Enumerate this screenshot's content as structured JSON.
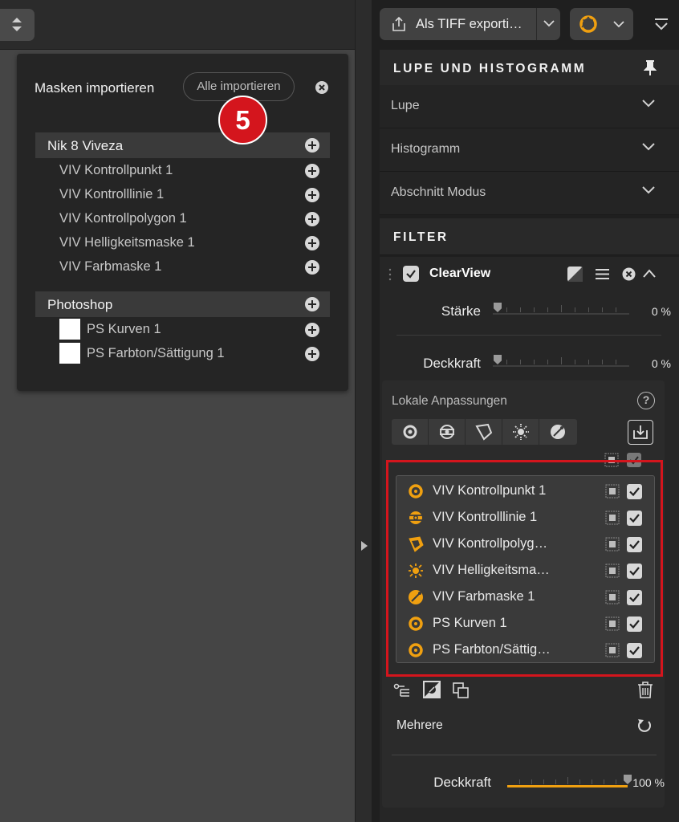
{
  "left": {
    "popup": {
      "title": "Masken importieren",
      "import_all_label": "Alle importieren",
      "step_badge": "5",
      "groups": [
        {
          "name": "Nik 8 Viveza",
          "items": [
            "VIV Kontrollpunkt 1",
            "VIV Kontrolllinie 1",
            "VIV Kontrollpolygon 1",
            "VIV Helligkeitsmaske 1",
            "VIV Farbmaske 1"
          ]
        },
        {
          "name": "Photoshop",
          "items": [
            "PS Kurven 1",
            "PS Farbton/Sättigung 1"
          ]
        }
      ]
    }
  },
  "right": {
    "export_label": "Als TIFF exporti…",
    "sections": {
      "lupe_histogramm": "LUPE UND HISTOGRAMM",
      "lupe": "Lupe",
      "histogramm": "Histogramm",
      "abschnitt_modus": "Abschnitt Modus",
      "filter": "FILTER"
    },
    "clearview": {
      "title": "ClearView",
      "staerke_label": "Stärke",
      "staerke_value": "0 %",
      "deckkraft_label": "Deckkraft",
      "deckkraft_value": "0 %"
    },
    "local": {
      "title": "Lokale Anpassungen",
      "help": "?",
      "masks": [
        {
          "label": "VIV Kontrollpunkt 1",
          "icon": "control-point-icon"
        },
        {
          "label": "VIV Kontrolllinie 1",
          "icon": "control-line-icon"
        },
        {
          "label": "VIV Kontrollpolyg…",
          "icon": "control-polygon-icon"
        },
        {
          "label": "VIV Helligkeitsma…",
          "icon": "luminosity-mask-icon"
        },
        {
          "label": "VIV Farbmaske 1",
          "icon": "color-mask-icon"
        },
        {
          "label": "PS Kurven 1",
          "icon": "control-point-icon"
        },
        {
          "label": "PS Farbton/Sättig…",
          "icon": "control-point-icon"
        }
      ],
      "mehrere_label": "Mehrere",
      "deckkraft_label": "Deckkraft",
      "deckkraft_value": "100 %",
      "deckkraft_level": 1.0
    }
  },
  "colors": {
    "accent_orange": "#f0a010",
    "highlight_red": "#d4151d",
    "badge_red": "#d4151d"
  }
}
